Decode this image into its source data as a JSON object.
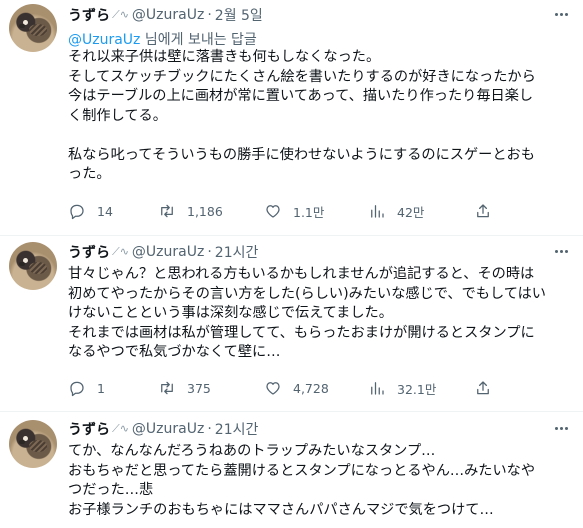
{
  "tweets": [
    {
      "author_name": "うずら",
      "name_deco": "🐦",
      "handle": "@UzuraUz",
      "time": "2월 5일",
      "reply_prefix": "@UzuraUz",
      "reply_suffix": " 님에게 보내는 답글",
      "lines": [
        "それ以来子供は壁に落書きも何もしなくなった。",
        "そしてスケッチブックにたくさん絵を書いたりするのが好きになったから",
        "今はテーブルの上に画材が常に置いてあって、描いたり作ったり毎日楽し",
        "く制作してる。",
        "",
        "私なら叱ってそういうもの勝手に使わせないようにするのにスゲーとおも",
        "った。"
      ],
      "replies": "14",
      "retweets": "1,186",
      "likes": "1.1만",
      "views": "42만"
    },
    {
      "author_name": "うずら",
      "name_deco": "🐦",
      "handle": "@UzuraUz",
      "time": "21시간",
      "lines": [
        "甘々じゃん？と思われる方もいるかもしれませんが追記すると、その時は",
        "初めてやったからその言い方をした(らしい)みたいな感じで、でもしてはい",
        "けないことという事は深刻な感じで伝えてました。",
        "それまでは画材は私が管理してて、もらったおまけが開けるとスタンプに",
        "なるやつで私気づかなくて壁に…"
      ],
      "replies": "1",
      "retweets": "375",
      "likes": "4,728",
      "views": "32.1만"
    },
    {
      "author_name": "うずら",
      "name_deco": "🐦",
      "handle": "@UzuraUz",
      "time": "21시간",
      "lines": [
        "てか、なんなんだろうねあのトラップみたいなスタンプ…",
        "おもちゃだと思ってたら蓋開けるとスタンプになっとるやん…みたいなや",
        "つだった…悲",
        "お子様ランチのおもちゃにはママさんパパさんマジで気をつけて…"
      ]
    }
  ],
  "icons": {
    "reply": "reply-icon",
    "retweet": "retweet-icon",
    "like": "like-icon",
    "views": "views-icon",
    "share": "share-icon",
    "more": "more-icon"
  },
  "colors": {
    "text": "#0f1419",
    "secondary": "#536471",
    "link": "#1d9bf0",
    "divider": "#eff3f4"
  }
}
